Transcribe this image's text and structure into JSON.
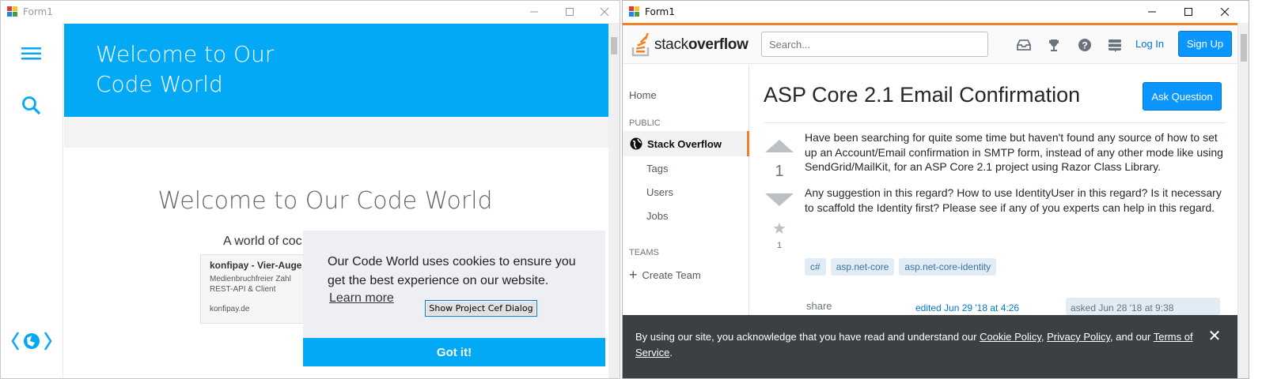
{
  "left_window": {
    "title": "Form1",
    "hero_title": "Welcome to Our Code World",
    "main_heading": "Welcome to Our Code World",
    "subheading": "A world of coc",
    "ad": {
      "title": "konfipay - Vier-Auge",
      "line1": "Medienbruchfreier Zahl",
      "line2": "REST-API & Client",
      "domain": "konfipay.de"
    },
    "cookie": {
      "message": "Our Code World uses cookies to ensure you get the best experience on our website.",
      "learn_more": "Learn more",
      "cef_button": "Show Project Cef Dialog",
      "got_it": "Got it!"
    },
    "colors": {
      "accent": "#03a9f4"
    }
  },
  "right_window": {
    "title": "Form1",
    "header": {
      "logo_prefix": "stack",
      "logo_suffix": "overflow",
      "search_placeholder": "Search...",
      "icons": [
        "inbox-icon",
        "trophy-icon",
        "help-icon",
        "stack-exchange-icon"
      ],
      "login": "Log In",
      "signup": "Sign Up"
    },
    "nav": {
      "home": "Home",
      "public": "PUBLIC",
      "stack_overflow": "Stack Overflow",
      "tags": "Tags",
      "users": "Users",
      "jobs": "Jobs",
      "teams": "TEAMS",
      "create_team": "Create Team"
    },
    "question": {
      "title": "ASP Core 2.1 Email Confirmation",
      "ask_button": "Ask Question",
      "votes": "1",
      "favorites": "1",
      "paragraphs": [
        "Have been searching for quite some time but haven't found any source of how to set up an Account/Email confirmation in SMTP form, instead of any other mode like using SendGrid/MailKit, for an ASP Core 2.1 project using Razor Class Library.",
        "Any suggestion in this regard? How to use IdentityUser in this regard? Is it necessary to scaffold the Identity first? Please see if any of you experts can help in this regard."
      ],
      "tags": [
        "c#",
        "asp.net-core",
        "asp.net-core-identity"
      ],
      "share": "share",
      "edited": "edited Jun 29 '18 at 4:26",
      "asked": "asked Jun 28 '18 at 9:38"
    },
    "cookie_banner": {
      "text_before": "By using our site, you acknowledge that you have read and understand our ",
      "cookie_policy": "Cookie Policy",
      "sep1": ", ",
      "privacy_policy": "Privacy Policy",
      "sep2": ", and our ",
      "terms": "Terms of Service",
      "end": ".",
      "close": "✕"
    },
    "colors": {
      "orange": "#f48024",
      "blue": "#0a95ff",
      "tag_bg": "#e1ecf4"
    }
  }
}
